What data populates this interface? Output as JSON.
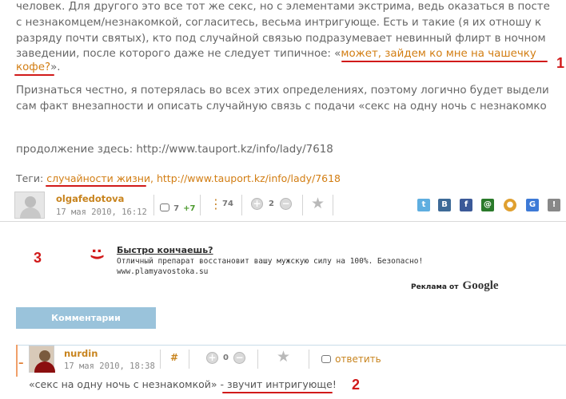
{
  "article": {
    "line1": "человек. Для другого это все тот же секс, но с элементами экстрима, ведь оказаться в посте",
    "line2": "с незнакомцем/незнакомкой, согласитесь, весьма интригующе. Есть и такие (я их отношу к",
    "line3": "разряду почти святых), кто под случайной связью подразумевает невинный флирт в ночном",
    "line4_before": "заведении, после которого даже не следует типичное: «",
    "line4_link": "может, зайдем ко мне на чашечку",
    "line5_link": "кофе?",
    "line5_after": "».",
    "para2_line1": "Признаться честно, я потерялась во всех этих определениях, поэтому логично будет выдели",
    "para2_line2": "сам факт внезапности и описать случайную связь с подачи «секс на одну ночь с незнакомко",
    "continuation": "продолжение здесь: http://www.tauport.kz/info/lady/7618",
    "tags_label": "Теги: ",
    "tag1": "случайности жизни",
    "tag_sep": ", ",
    "tag2": "http://www.tauport.kz/info/lady/7618"
  },
  "post_meta": {
    "username": "olgafedotova",
    "date": "17 мая 2010, 16:12",
    "comments_count": "7",
    "comments_new": "+7",
    "views": "74",
    "rating": "2"
  },
  "share_icons": [
    "twitter-icon",
    "vkontakte-icon",
    "facebook-icon",
    "mail-icon",
    "livejournal-icon",
    "google-buzz-icon",
    "google-icon"
  ],
  "share_labels": [
    "t",
    "B",
    "f",
    "@",
    "●",
    "G",
    "!"
  ],
  "share_colors": [
    "#5eaee0",
    "#3d6a97",
    "#3b5998",
    "#2a7a2a",
    "#e0a030",
    "#3d7ad6",
    "#888888"
  ],
  "ad": {
    "title": "Быстро кончаешь?",
    "body": "Отличный препарат восстановит вашу мужскую силу на 100%. Безопасно!",
    "url": "www.plamyavostoka.su",
    "google_prefix": "Реклама от",
    "google_word": "Google"
  },
  "comments_button": "Комментарии",
  "comment": {
    "collapse": "–",
    "username": "nurdin",
    "date": "17 мая 2010, 18:38",
    "hash": "#",
    "rating": "0",
    "reply": "ответить",
    "text_before": "«секс на одну ночь с незнакомкой» - ",
    "text_highlight": "звучит интригующе",
    "text_after": "!"
  },
  "annotations": {
    "mark1": "1",
    "mark2": "2",
    "mark3": "3",
    "ad_icon": ":)"
  }
}
